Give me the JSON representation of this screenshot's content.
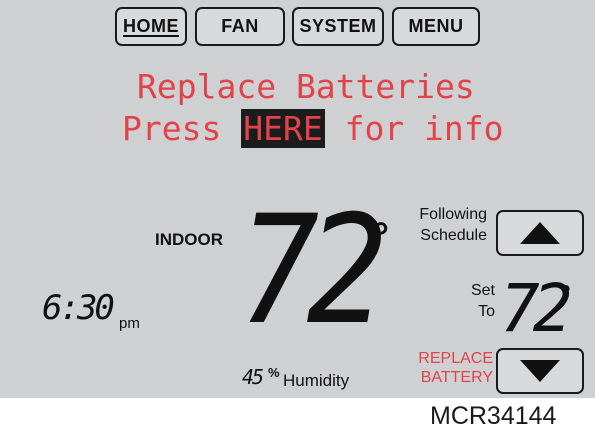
{
  "tabs": {
    "home": "HOME",
    "fan": "FAN",
    "system": "SYSTEM",
    "menu": "MENU"
  },
  "message": {
    "line1": "Replace Batteries",
    "line2_prefix": "Press ",
    "line2_highlight": "HERE",
    "line2_suffix": " for info"
  },
  "indoor": {
    "label": "INDOOR",
    "temperature": "72",
    "degree": "°"
  },
  "clock": {
    "time": "6:30",
    "ampm": "pm"
  },
  "humidity": {
    "value": "45",
    "percent": "%",
    "label": "Humidity"
  },
  "schedule": {
    "status_line1": "Following",
    "status_line2": "Schedule"
  },
  "setpoint": {
    "label_line1": "Set",
    "label_line2": "To",
    "temperature": "72",
    "degree": "°"
  },
  "warning": {
    "line1": "REPLACE",
    "line2": "BATTERY"
  },
  "caption": "MCR34144",
  "colors": {
    "screen": "#cfd0d2",
    "alert_red": "#e2434a",
    "text_dark": "#111111"
  },
  "icons": {
    "up": "triangle-up",
    "down": "triangle-down"
  }
}
